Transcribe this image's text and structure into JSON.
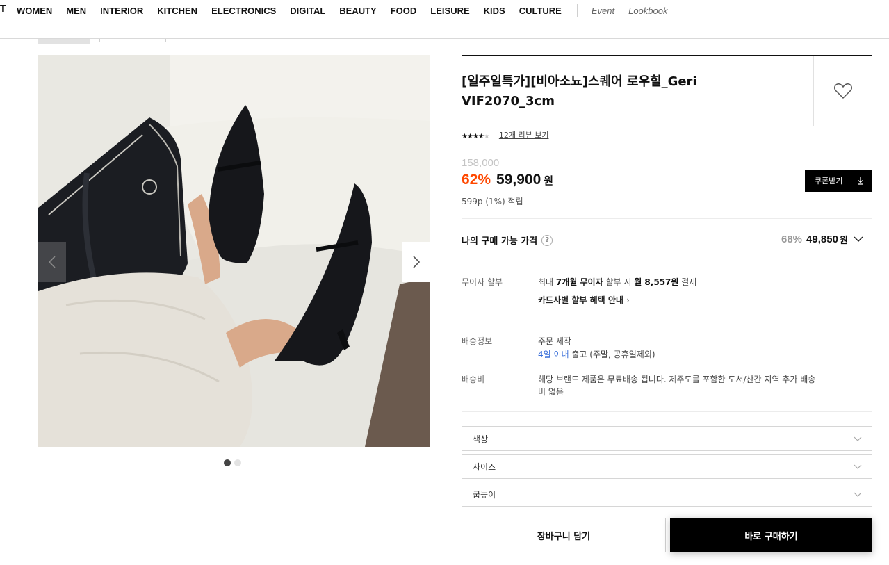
{
  "nav": {
    "cut_glyph": "T",
    "items": [
      "WOMEN",
      "MEN",
      "INTERIOR",
      "KITCHEN",
      "ELECTRONICS",
      "DIGITAL",
      "BEAUTY",
      "FOOD",
      "LEISURE",
      "KIDS",
      "CULTURE"
    ],
    "sub_items": [
      "Event",
      "Lookbook"
    ]
  },
  "gallery": {
    "image_icon": "product-photo-shoes",
    "prev_icon": "chevron-left-icon",
    "next_icon": "chevron-right-icon",
    "slide_count": 2,
    "active_slide": 1
  },
  "product": {
    "title_line1": "[일주일특가][비아소뇨]스퀘어 로우힐_Geri",
    "title_line2": "VIF2070_3cm",
    "wish_icon": "heart-outline-icon",
    "rating_stars": 4,
    "rating_max": 5,
    "review_link": "12개 리뷰 보기",
    "original_price": "158,000",
    "discount": "62%",
    "sale_price": "59,900",
    "currency": "원",
    "points": "599p (1%) 적립",
    "coupon_label": "쿠폰받기",
    "coupon_icon": "download-icon"
  },
  "my_price": {
    "label": "나의 구매 가능 가격",
    "help_icon": "question-circle-icon",
    "help_glyph": "?",
    "discount": "68%",
    "amount": "49,850",
    "currency": "원",
    "chevron_icon": "chevron-down-icon"
  },
  "installment": {
    "label": "무이자 할부",
    "text_pre": "최대 ",
    "text_bold1": "7개월 무이자",
    "text_mid": " 할부 시 ",
    "text_bold2": "월 8,557원",
    "text_post": " 결제",
    "card_link": "카드사별 할부 혜택 안내",
    "card_link_arrow": "›"
  },
  "shipping": {
    "label": "배송정보",
    "line1": "주문 제작",
    "line2_blue": "4일 이내",
    "line2_rest": " 출고 (주말, 공휴일제외)"
  },
  "shipping_fee": {
    "label": "배송비",
    "line1": "해당 브랜드 제품은 무료배송 됩니다. 제주도를 포함한 도서/산간 지역 추가 배송",
    "line2": "비 없음"
  },
  "options": [
    {
      "label": "색상"
    },
    {
      "label": "사이즈"
    },
    {
      "label": "굽높이"
    }
  ],
  "actions": {
    "cart": "장바구니 담기",
    "buy": "바로 구매하기"
  },
  "colors": {
    "accent_discount": "#ff4800",
    "link_blue": "#3a6fd9",
    "button_black": "#000000"
  }
}
